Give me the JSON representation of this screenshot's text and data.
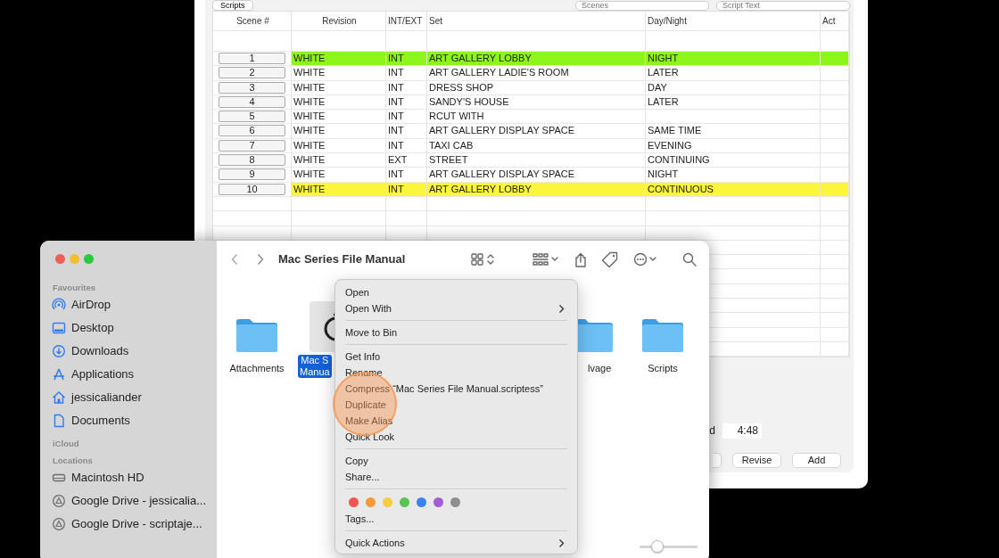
{
  "script_window": {
    "toolbar": {
      "button": "Scripts",
      "search_fields": [
        {
          "placeholder": "Scenes"
        },
        {
          "placeholder": "Script Text"
        }
      ]
    },
    "table": {
      "columns": [
        "Scene #",
        "Revision",
        "INT/EXT",
        "Set",
        "Day/Night",
        "Act"
      ],
      "rows": [
        {
          "scene": "1",
          "revision": "WHITE",
          "int_ext": "INT",
          "set": "ART GALLERY LOBBY",
          "day_night": "NIGHT",
          "color": "#8ef51a"
        },
        {
          "scene": "2",
          "revision": "WHITE",
          "int_ext": "INT",
          "set": "ART GALLERY LADIE'S ROOM",
          "day_night": "LATER",
          "color": "#ffffff"
        },
        {
          "scene": "3",
          "revision": "WHITE",
          "int_ext": "INT",
          "set": "DRESS SHOP",
          "day_night": "DAY",
          "color": "#ffffff"
        },
        {
          "scene": "4",
          "revision": "WHITE",
          "int_ext": "INT",
          "set": "SANDY'S HOUSE",
          "day_night": "LATER",
          "color": "#ffffff"
        },
        {
          "scene": "5",
          "revision": "WHITE",
          "int_ext": "INT",
          "set": "RCUT WITH",
          "day_night": "",
          "color": "#ffffff"
        },
        {
          "scene": "6",
          "revision": "WHITE",
          "int_ext": "INT",
          "set": "ART GALLERY DISPLAY SPACE",
          "day_night": "SAME TIME",
          "color": "#ffffff"
        },
        {
          "scene": "7",
          "revision": "WHITE",
          "int_ext": "INT",
          "set": "TAXI CAB",
          "day_night": "EVENING",
          "color": "#ffffff"
        },
        {
          "scene": "8",
          "revision": "WHITE",
          "int_ext": "EXT",
          "set": "STREET",
          "day_night": "CONTINUING",
          "color": "#ffffff"
        },
        {
          "scene": "9",
          "revision": "WHITE",
          "int_ext": "INT",
          "set": "ART GALLERY DISPLAY SPACE",
          "day_night": "NIGHT",
          "color": "#ffffff"
        },
        {
          "scene": "10",
          "revision": "WHITE",
          "int_ext": "INT",
          "set": "ART GALLERY LOBBY",
          "day_night": "CONTINUOUS",
          "color": "#fbf63c"
        }
      ]
    },
    "time_label": "d",
    "time_value": "4:48",
    "buttons": [
      "Revise",
      "Add"
    ]
  },
  "finder": {
    "title": "Mac Series File Manual",
    "sidebar": [
      {
        "heading": "Favourites",
        "items": [
          {
            "label": "AirDrop",
            "kind": "airdrop"
          },
          {
            "label": "Desktop",
            "kind": "desktop"
          },
          {
            "label": "Downloads",
            "kind": "downloads"
          },
          {
            "label": "Applications",
            "kind": "applications"
          },
          {
            "label": "jessicaliander",
            "kind": "home"
          },
          {
            "label": "Documents",
            "kind": "documents"
          }
        ]
      },
      {
        "heading": "iCloud"
      },
      {
        "heading": "Locations",
        "items": [
          {
            "label": "Macintosh HD",
            "kind": "disk"
          },
          {
            "label": "Google Drive - jessicalia...",
            "kind": "drive"
          },
          {
            "label": "Google Drive - scriptaje...",
            "kind": "drive"
          }
        ]
      }
    ],
    "files": [
      {
        "name_lines": [
          "Attachments"
        ],
        "kind": "folder",
        "selected": false
      },
      {
        "name_lines": [
          "Mac S",
          "Manua"
        ],
        "kind": "document",
        "selected": true
      },
      {
        "name_lines": [
          "lvage"
        ],
        "kind": "folder-cut",
        "selected": false
      },
      {
        "name_lines": [
          "Scripts"
        ],
        "kind": "folder",
        "selected": false
      }
    ],
    "context_menu": [
      {
        "kind": "item",
        "label": "Open"
      },
      {
        "kind": "submenu",
        "label": "Open With"
      },
      {
        "kind": "separator"
      },
      {
        "kind": "item",
        "label": "Move to Bin"
      },
      {
        "kind": "separator"
      },
      {
        "kind": "item",
        "label": "Get Info"
      },
      {
        "kind": "item",
        "label": "Rename"
      },
      {
        "kind": "item",
        "label": "Compress “Mac Series File Manual.scriptess”"
      },
      {
        "kind": "item",
        "label": "Duplicate"
      },
      {
        "kind": "item",
        "label": "Make Alias"
      },
      {
        "kind": "item",
        "label": "Quick Look"
      },
      {
        "kind": "separator"
      },
      {
        "kind": "item",
        "label": "Copy"
      },
      {
        "kind": "item",
        "label": "Share..."
      },
      {
        "kind": "separator"
      },
      {
        "kind": "tags",
        "colors": [
          {
            "color": "#f25450"
          },
          {
            "color": "#f59a36"
          },
          {
            "color": "#f6cb3c"
          },
          {
            "color": "#5ac351"
          },
          {
            "color": "#3a84f2"
          },
          {
            "color": "#a35cd6"
          },
          {
            "color": "#8e8e93"
          }
        ]
      },
      {
        "kind": "item",
        "label": "Tags..."
      },
      {
        "kind": "separator"
      },
      {
        "kind": "submenu",
        "label": "Quick Actions"
      }
    ],
    "icon_size_slider": {
      "level": 0.25
    }
  }
}
